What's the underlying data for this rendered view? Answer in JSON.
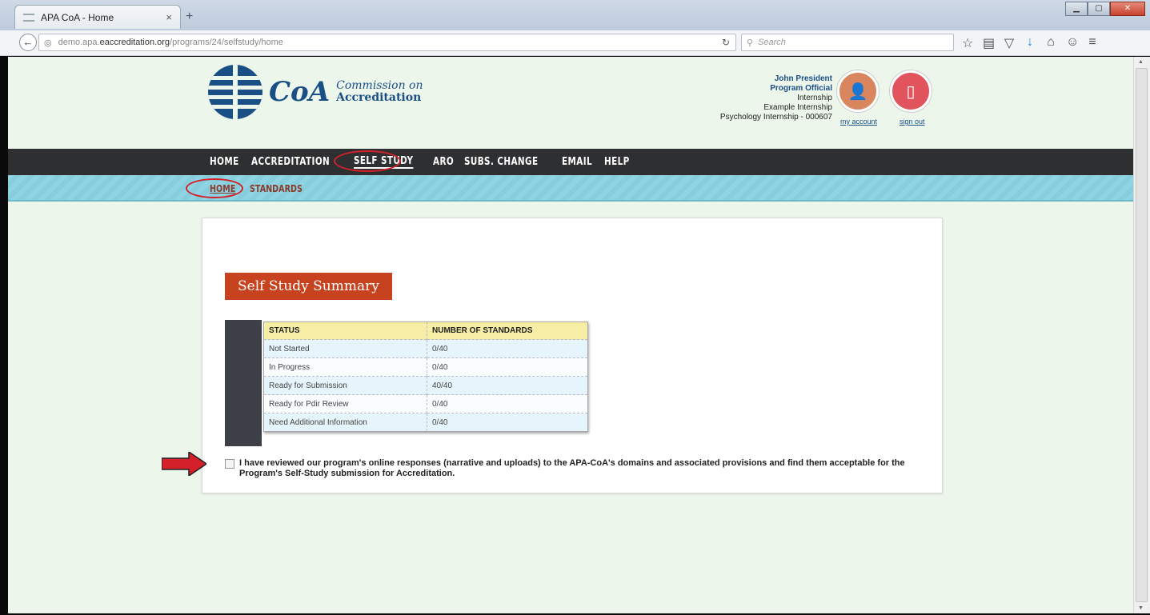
{
  "browser": {
    "tab_title": "APA CoA - Home",
    "tab_close": "×",
    "new_tab": "+",
    "url_prefix": "demo.apa.",
    "url_host": "eaccreditation.org",
    "url_path": "/programs/24/selfstudy/home",
    "search_placeholder": "Search",
    "window_buttons": [
      "minimize",
      "maximize",
      "close"
    ]
  },
  "header": {
    "logo_word": "CoA",
    "logo_line1": "Commission on",
    "logo_line2": "Accreditation",
    "user": {
      "name": "John President",
      "role": "Program Official",
      "program_type": "Internship",
      "program_name": "Example Internship",
      "program_id": "Psychology Internship - 000607"
    },
    "my_account": "my account",
    "sign_out": "sign out"
  },
  "main_nav": {
    "items": [
      {
        "label": "HOME",
        "active": false
      },
      {
        "label": "ACCREDITATION",
        "active": false
      },
      {
        "label": "SELF STUDY",
        "active": true
      },
      {
        "label": "ARO",
        "active": false
      },
      {
        "label": "SUBS. CHANGE",
        "active": false
      },
      {
        "label": "EMAIL",
        "active": false
      },
      {
        "label": "HELP",
        "active": false
      }
    ]
  },
  "sub_nav": {
    "items": [
      {
        "label": "HOME",
        "active": true
      },
      {
        "label": "STANDARDS",
        "active": false
      }
    ]
  },
  "summary": {
    "title": "Self Study Summary",
    "columns": [
      "STATUS",
      "NUMBER OF STANDARDS"
    ],
    "rows": [
      {
        "status": "Not Started",
        "count": "0/40"
      },
      {
        "status": "In Progress",
        "count": "0/40"
      },
      {
        "status": "Ready for Submission",
        "count": "40/40"
      },
      {
        "status": "Ready for Pdir Review",
        "count": "0/40"
      },
      {
        "status": "Need Additional Information",
        "count": "0/40"
      }
    ],
    "attestation": "I have reviewed our program's online responses (narrative and uploads) to the APA-CoA's domains and associated provisions and find them acceptable for the Program's Self-Study submission for Accreditation.",
    "attestation_checked": false
  },
  "colors": {
    "accent_orange": "#c7431f",
    "brand_blue": "#1a4f86",
    "nav_dark": "#2e2f31",
    "subnav_teal": "#8fd4e3",
    "annotation_red": "#d4202a"
  }
}
